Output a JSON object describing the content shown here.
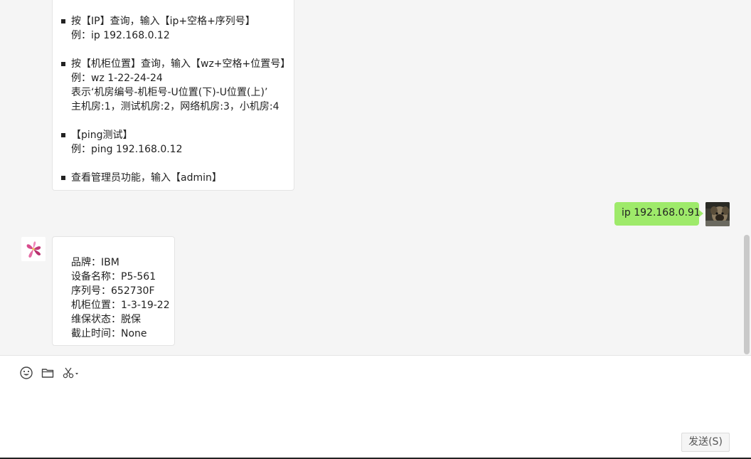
{
  "conversation": {
    "help_message": {
      "lines": [
        "按【IP】查询，输入【ip+空格+序列号】",
        "例：ip 192.168.0.12",
        "按【机柜位置】查询，输入【wz+空格+位置号】",
        "例：wz 1-22-24-24",
        "表示‘机房编号-机柜号-U位置(下)-U位置(上)’",
        "主机房:1，测试机房:2，网络机房:3，小机房:4",
        "【ping测试】",
        " 例：ping 192.168.0.12",
        "查看管理员功能，输入【admin】"
      ]
    },
    "sent_message": {
      "text": "ip 192.168.0.91"
    },
    "reply_message": {
      "lines": [
        "品牌：IBM",
        "设备名称：P5-561",
        "序列号：652730F",
        "机柜位置：1-3-19-22",
        "维保状态：脱保",
        "截止时间：None"
      ]
    }
  },
  "toolbar": {
    "icons": [
      "emoji-icon",
      "folder-icon",
      "scissors-icon"
    ]
  },
  "composer": {
    "send_label": "发送(S)"
  },
  "colors": {
    "sent_bubble": "#9eea6a",
    "chat_background": "#f5f5f5"
  }
}
